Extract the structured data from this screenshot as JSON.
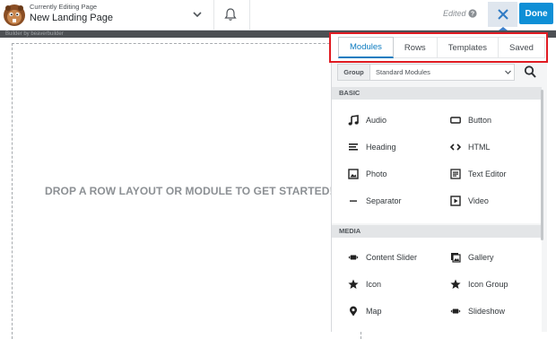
{
  "header": {
    "subtitle": "Currently Editing Page",
    "page_title": "New Landing Page",
    "status": "Edited",
    "done_label": "Done",
    "strip_text": "Builder by beaverbuilder"
  },
  "canvas": {
    "prompt": "DROP A ROW LAYOUT OR MODULE TO GET STARTED!"
  },
  "panel": {
    "tabs": [
      {
        "label": "Modules"
      },
      {
        "label": "Rows"
      },
      {
        "label": "Templates"
      },
      {
        "label": "Saved"
      }
    ],
    "group_label": "Group",
    "group_value": "Standard Modules",
    "sections": [
      {
        "title": "BASIC",
        "modules": [
          {
            "label": "Audio",
            "icon": "music-note-icon"
          },
          {
            "label": "Button",
            "icon": "button-icon"
          },
          {
            "label": "Heading",
            "icon": "heading-icon"
          },
          {
            "label": "HTML",
            "icon": "code-icon"
          },
          {
            "label": "Photo",
            "icon": "photo-icon"
          },
          {
            "label": "Text Editor",
            "icon": "text-editor-icon"
          },
          {
            "label": "Separator",
            "icon": "separator-icon"
          },
          {
            "label": "Video",
            "icon": "video-icon"
          }
        ]
      },
      {
        "title": "MEDIA",
        "modules": [
          {
            "label": "Content Slider",
            "icon": "slider-icon"
          },
          {
            "label": "Gallery",
            "icon": "gallery-icon"
          },
          {
            "label": "Icon",
            "icon": "star-icon"
          },
          {
            "label": "Icon Group",
            "icon": "star-icon"
          },
          {
            "label": "Map",
            "icon": "map-pin-icon"
          },
          {
            "label": "Slideshow",
            "icon": "slideshow-icon"
          }
        ]
      }
    ]
  },
  "colors": {
    "accent": "#0e8fd6",
    "tab_active": "#0e7cc0",
    "highlight_border": "#e01b22"
  }
}
